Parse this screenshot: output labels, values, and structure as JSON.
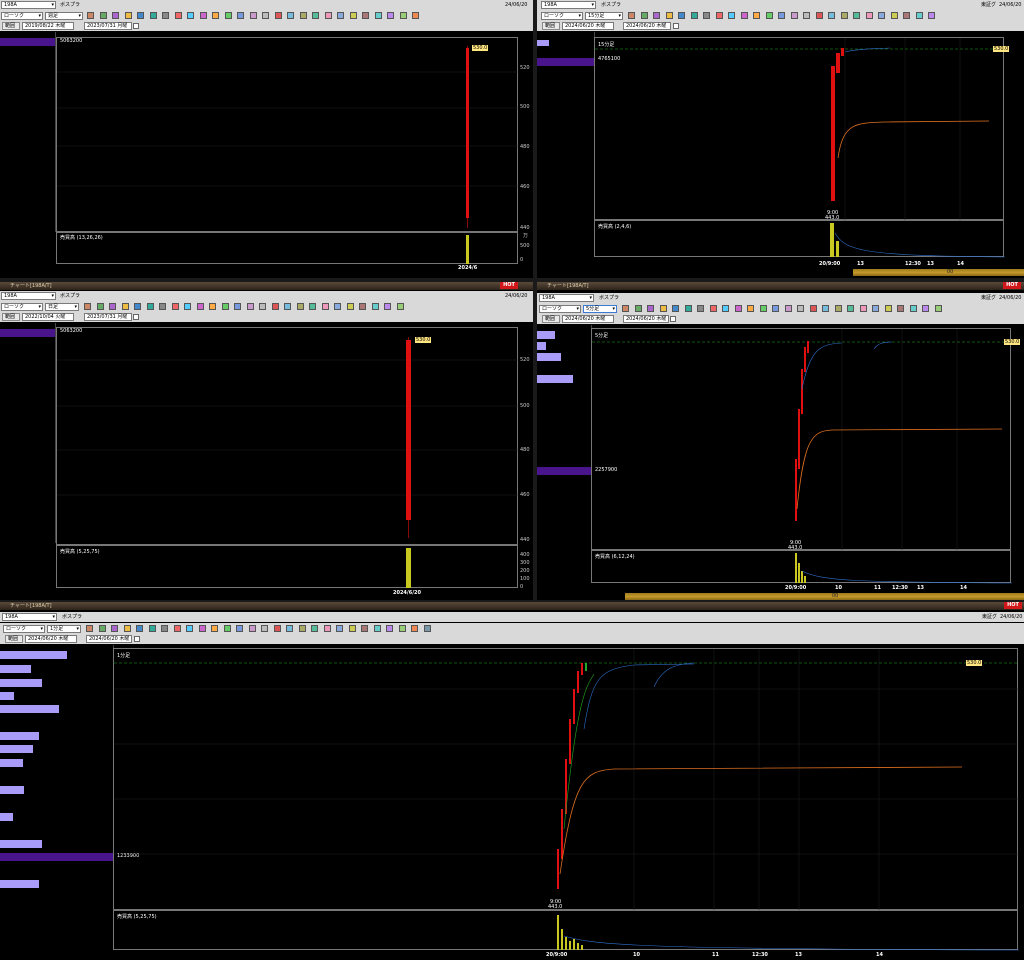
{
  "panels": {
    "p1": {
      "symbol": "198A",
      "source": "ボスプラ",
      "date": "24/06/20",
      "chart_style": "ローソク",
      "period": "週足",
      "from_date": "2019/08/22 木曜",
      "to_date": "2023/07/31 月曜",
      "nav_label": "範囲",
      "marker_value": "5063200",
      "price_tag": "530.0",
      "y_labels": [
        "520",
        "500",
        "480",
        "460",
        "440"
      ],
      "vol_title": "売買高 (13,26,26)",
      "vol_unit": "万",
      "vol_labels": [
        "500",
        "0"
      ],
      "x_label": "2024/6"
    },
    "p2": {
      "symbol": "198A",
      "source": "ボスプラ",
      "exchange": "東証グ",
      "date": "24/06/20",
      "chart_style": "ローソク",
      "period": "15分足",
      "from_date": "2024/06/20 木曜",
      "to_date": "2024/06/20 木曜",
      "nav_label": "範囲",
      "period_tag": "15分足",
      "marker_value": "4765100",
      "price_tag": "530.0",
      "low_time": "9:00",
      "low_price": "443.0",
      "vol_title": "売買高 (2,4,6)",
      "x_labels": [
        "20/9:00",
        "13",
        "12:30",
        "13",
        "14"
      ],
      "scroll_label": "00"
    },
    "p3": {
      "window_title": "チャート[198A/T]",
      "hot": "HOT",
      "symbol": "198A",
      "source": "ボスプラ",
      "date": "24/06/20",
      "chart_style": "ローソク",
      "period": "日足",
      "from_date": "2022/10/04 火曜",
      "to_date": "2023/07/31 月曜",
      "nav_label": "範囲",
      "marker_value": "5063200",
      "price_tag": "530.0",
      "y_labels": [
        "520",
        "500",
        "480",
        "460",
        "440"
      ],
      "vol_title": "売買高 (5,25,75)",
      "vol_labels": [
        "400",
        "300",
        "200",
        "100",
        "0"
      ],
      "x_label": "2024/6/20"
    },
    "p4": {
      "window_title": "チャート[198A/T]",
      "hot": "HOT",
      "symbol": "198A",
      "source": "ボスプラ",
      "exchange": "東証グ",
      "date": "24/06/20",
      "chart_style": "ローソク",
      "period": "5分足",
      "from_date": "2024/06/20 木曜",
      "to_date": "2024/06/20 木曜",
      "nav_label": "範囲",
      "period_tag": "5分足",
      "marker_value": "2257900",
      "price_tag": "530.0",
      "low_time": "9:00",
      "low_price": "443.0",
      "vol_title": "売買高 (6,12,24)",
      "x_labels": [
        "20/9:00",
        "10",
        "11",
        "12:30",
        "13",
        "14"
      ],
      "scroll_label": "00"
    },
    "p5": {
      "window_title": "チャート[198A/T]",
      "hot": "HOT",
      "symbol": "198A",
      "source": "ボスプラ",
      "exchange": "東証グ",
      "date": "24/06/20",
      "chart_style": "ローソク",
      "period": "1分足",
      "from_date": "2024/06/20 木曜",
      "to_date": "2024/06/20 木曜",
      "nav_label": "範囲",
      "period_tag": "1分足",
      "marker_value": "1233900",
      "price_tag": "530.0",
      "low_time": "9:00",
      "low_price": "443.0",
      "vol_title": "売買高 (5,25,75)",
      "x_labels": [
        "20/9:00",
        "10",
        "11",
        "12:30",
        "13",
        "14"
      ]
    }
  },
  "chart_data": [
    {
      "type": "bar",
      "title": "",
      "period": "週足",
      "categories": [
        "2024/6"
      ],
      "open": [
        443
      ],
      "close": [
        530
      ],
      "high": [
        530
      ],
      "low": [
        443
      ],
      "ylim": [
        440,
        530
      ]
    },
    {
      "type": "bar",
      "title": "",
      "period": "15分足",
      "x": [
        "20/9:00",
        "13",
        "12:30",
        "13",
        "14"
      ],
      "low": 443,
      "high": 530
    },
    {
      "type": "bar",
      "title": "",
      "period": "日足",
      "categories": [
        "2024/6/20"
      ],
      "open": [
        443
      ],
      "close": [
        530
      ],
      "high": [
        530
      ],
      "low": [
        443
      ],
      "ylim": [
        440,
        530
      ]
    },
    {
      "type": "bar",
      "title": "",
      "period": "5分足",
      "x": [
        "20/9:00",
        "10",
        "11",
        "12:30",
        "13",
        "14"
      ],
      "low": 443,
      "high": 530
    },
    {
      "type": "bar",
      "title": "",
      "period": "1分足",
      "x": [
        "20/9:00",
        "10",
        "11",
        "12:30",
        "13",
        "14"
      ],
      "low": 443,
      "high": 530
    }
  ],
  "colors": {
    "up": "#e01010",
    "vol": "#c8c820",
    "profile": "#a89cf8",
    "profile_dark": "#4a148c",
    "price_line": "#22aa22",
    "ma_orange": "#e07020",
    "ma_blue": "#3070d0"
  }
}
